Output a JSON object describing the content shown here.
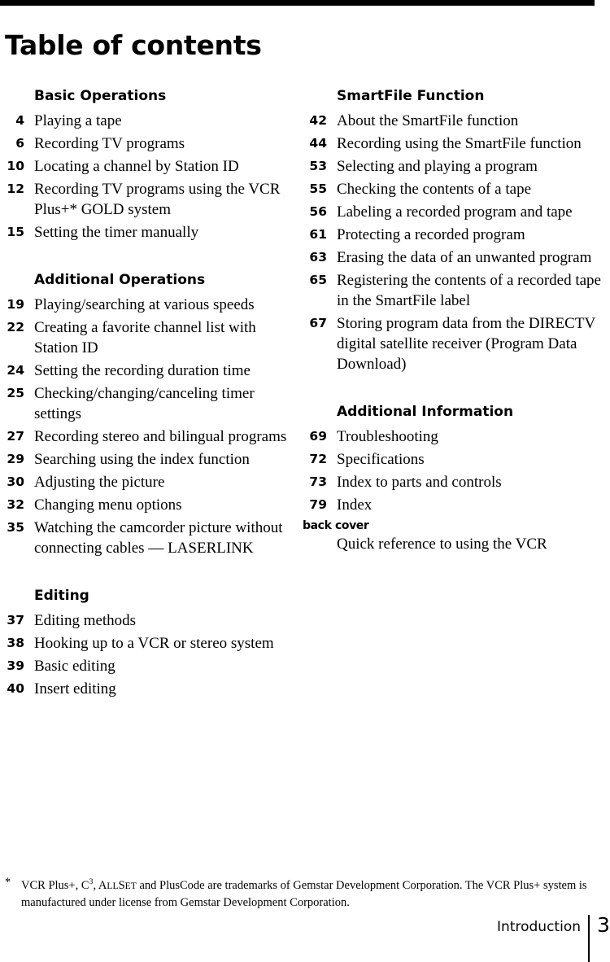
{
  "document": {
    "title": "Table of contents",
    "footer": {
      "chapter_label": "Introduction",
      "page_number": "3"
    },
    "footnote": {
      "marker": "*",
      "part1": "VCR Plus+, C",
      "part1_sup": "3",
      "part2": ", ",
      "allset_a": "A",
      "allset_ll": "LL",
      "allset_s": "S",
      "allset_et": "ET",
      "part3": " and PlusCode are trademarks of Gemstar Development Corporation.  The VCR Plus+ system is manufactured under license from Gemstar Development Corporation."
    }
  },
  "left_column": {
    "sections": [
      {
        "heading": "Basic Operations",
        "entries": [
          {
            "page": "4",
            "title": "Playing a tape"
          },
          {
            "page": "6",
            "title": "Recording TV programs"
          },
          {
            "page": "10",
            "title": "Locating a channel by Station ID"
          },
          {
            "page": "12",
            "title": "Recording TV programs using the VCR Plus+* GOLD system"
          },
          {
            "page": "15",
            "title": "Setting the timer manually"
          }
        ]
      },
      {
        "heading": "Additional Operations",
        "entries": [
          {
            "page": "19",
            "title": "Playing/searching at various speeds"
          },
          {
            "page": "22",
            "title": "Creating a favorite channel list with Station ID"
          },
          {
            "page": "24",
            "title": "Setting the recording duration time"
          },
          {
            "page": "25",
            "title": "Checking/changing/canceling timer settings"
          },
          {
            "page": "27",
            "title": "Recording stereo and bilingual programs"
          },
          {
            "page": "29",
            "title": "Searching using the index function"
          },
          {
            "page": "30",
            "title": "Adjusting the picture"
          },
          {
            "page": "32",
            "title": "Changing menu options"
          },
          {
            "page": "35",
            "title": "Watching the camcorder picture without connecting cables — LASERLINK"
          }
        ]
      },
      {
        "heading": "Editing",
        "entries": [
          {
            "page": "37",
            "title": "Editing methods"
          },
          {
            "page": "38",
            "title": "Hooking up to a VCR or stereo system"
          },
          {
            "page": "39",
            "title": "Basic editing"
          },
          {
            "page": "40",
            "title": "Insert editing"
          }
        ]
      }
    ]
  },
  "right_column": {
    "sections": [
      {
        "heading": "SmartFile Function",
        "entries": [
          {
            "page": "42",
            "title": "About the SmartFile function"
          },
          {
            "page": "44",
            "title": "Recording using the SmartFile function"
          },
          {
            "page": "53",
            "title": "Selecting and playing a program"
          },
          {
            "page": "55",
            "title": "Checking the contents of a tape"
          },
          {
            "page": "56",
            "title": "Labeling a recorded program and tape"
          },
          {
            "page": "61",
            "title": "Protecting a recorded program"
          },
          {
            "page": "63",
            "title": "Erasing the data of an unwanted program"
          },
          {
            "page": "65",
            "title": "Registering the contents of a recorded tape in the SmartFile label"
          },
          {
            "page": "67",
            "title": "Storing program data from the DIRECTV digital satellite receiver (Program Data Download)"
          }
        ]
      },
      {
        "heading": "Additional Information",
        "entries": [
          {
            "page": "69",
            "title": "Troubleshooting"
          },
          {
            "page": "72",
            "title": "Specifications"
          },
          {
            "page": "73",
            "title": "Index to parts and controls"
          },
          {
            "page": "79",
            "title": "Index"
          },
          {
            "page": "back cover",
            "title": "Quick reference to using the VCR",
            "stacked": true
          }
        ]
      }
    ]
  }
}
